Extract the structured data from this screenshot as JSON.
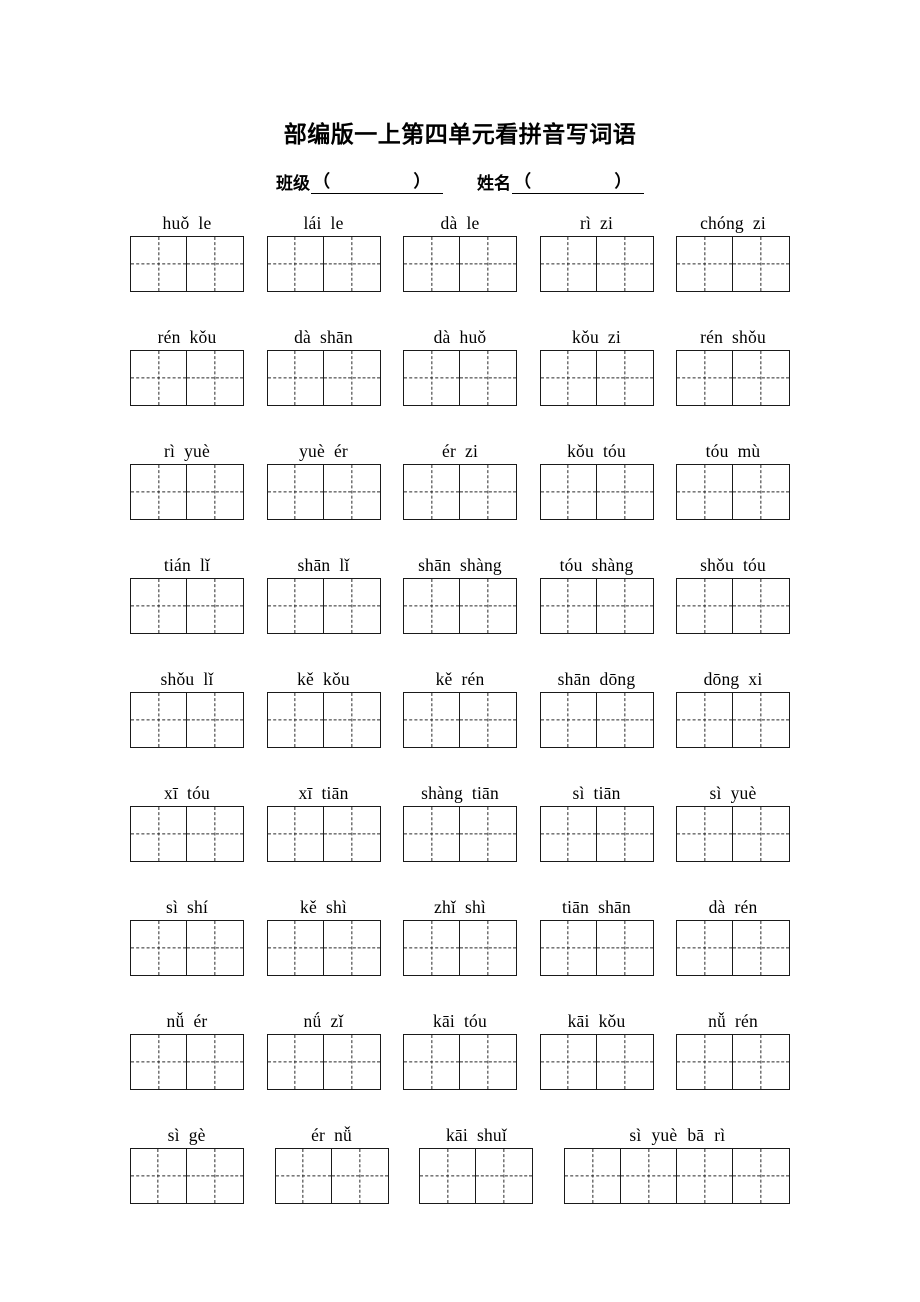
{
  "document": {
    "title": "部编版一上第四单元看拼音写词语",
    "fields": [
      {
        "label": "班级",
        "open": "（",
        "close": "）",
        "value": ""
      },
      {
        "label": "姓名",
        "open": "（",
        "close": "）",
        "value": ""
      }
    ]
  },
  "worksheet": {
    "rows": [
      {
        "items": [
          {
            "pinyin": [
              "huǒ",
              "le"
            ],
            "cells": 2
          },
          {
            "pinyin": [
              "lái",
              "le"
            ],
            "cells": 2
          },
          {
            "pinyin": [
              "dà",
              "le"
            ],
            "cells": 2
          },
          {
            "pinyin": [
              "rì",
              "zi"
            ],
            "cells": 2
          },
          {
            "pinyin": [
              "chóng",
              "zi"
            ],
            "cells": 2
          }
        ]
      },
      {
        "items": [
          {
            "pinyin": [
              "rén",
              "kǒu"
            ],
            "cells": 2
          },
          {
            "pinyin": [
              "dà",
              "shān"
            ],
            "cells": 2
          },
          {
            "pinyin": [
              "dà",
              "huǒ"
            ],
            "cells": 2
          },
          {
            "pinyin": [
              "kǒu",
              "zi"
            ],
            "cells": 2
          },
          {
            "pinyin": [
              "rén",
              "shǒu"
            ],
            "cells": 2
          }
        ]
      },
      {
        "items": [
          {
            "pinyin": [
              "rì",
              "yuè"
            ],
            "cells": 2
          },
          {
            "pinyin": [
              "yuè",
              "ér"
            ],
            "cells": 2
          },
          {
            "pinyin": [
              "ér",
              "zi"
            ],
            "cells": 2
          },
          {
            "pinyin": [
              "kǒu",
              "tóu"
            ],
            "cells": 2
          },
          {
            "pinyin": [
              "tóu",
              "mù"
            ],
            "cells": 2
          }
        ]
      },
      {
        "items": [
          {
            "pinyin": [
              "tián",
              "lǐ"
            ],
            "cells": 2
          },
          {
            "pinyin": [
              "shān",
              "lǐ"
            ],
            "cells": 2
          },
          {
            "pinyin": [
              "shān",
              "shàng"
            ],
            "cells": 2
          },
          {
            "pinyin": [
              "tóu",
              "shàng"
            ],
            "cells": 2
          },
          {
            "pinyin": [
              "shǒu",
              "tóu"
            ],
            "cells": 2
          }
        ]
      },
      {
        "items": [
          {
            "pinyin": [
              "shǒu",
              "lǐ"
            ],
            "cells": 2
          },
          {
            "pinyin": [
              "kě",
              "kǒu"
            ],
            "cells": 2
          },
          {
            "pinyin": [
              "kě",
              "rén"
            ],
            "cells": 2
          },
          {
            "pinyin": [
              "shān",
              "dōng"
            ],
            "cells": 2
          },
          {
            "pinyin": [
              "dōng",
              "xi"
            ],
            "cells": 2
          }
        ]
      },
      {
        "items": [
          {
            "pinyin": [
              "xī",
              "tóu"
            ],
            "cells": 2
          },
          {
            "pinyin": [
              "xī",
              "tiān"
            ],
            "cells": 2
          },
          {
            "pinyin": [
              "shàng",
              "tiān"
            ],
            "cells": 2
          },
          {
            "pinyin": [
              "sì",
              "tiān"
            ],
            "cells": 2
          },
          {
            "pinyin": [
              "sì",
              "yuè"
            ],
            "cells": 2
          }
        ]
      },
      {
        "items": [
          {
            "pinyin": [
              "sì",
              "shí"
            ],
            "cells": 2
          },
          {
            "pinyin": [
              "kě",
              "shì"
            ],
            "cells": 2
          },
          {
            "pinyin": [
              "zhǐ",
              "shì"
            ],
            "cells": 2
          },
          {
            "pinyin": [
              "tiān",
              "shān"
            ],
            "cells": 2
          },
          {
            "pinyin": [
              "dà",
              "rén"
            ],
            "cells": 2
          }
        ]
      },
      {
        "items": [
          {
            "pinyin": [
              "nǚ",
              "ér"
            ],
            "cells": 2
          },
          {
            "pinyin": [
              "nǘ",
              "zǐ"
            ],
            "cells": 2
          },
          {
            "pinyin": [
              "kāi",
              "tóu"
            ],
            "cells": 2
          },
          {
            "pinyin": [
              "kāi",
              "kǒu"
            ],
            "cells": 2
          },
          {
            "pinyin": [
              "nǚ",
              "rén"
            ],
            "cells": 2
          }
        ]
      },
      {
        "items": [
          {
            "pinyin": [
              "sì",
              "gè"
            ],
            "cells": 2
          },
          {
            "pinyin": [
              "ér",
              "nǚ"
            ],
            "cells": 2
          },
          {
            "pinyin": [
              "kāi",
              "shuǐ"
            ],
            "cells": 2
          },
          {
            "pinyin": [
              "sì",
              "yuè",
              "bā",
              "rì"
            ],
            "cells": 4
          }
        ]
      }
    ]
  }
}
